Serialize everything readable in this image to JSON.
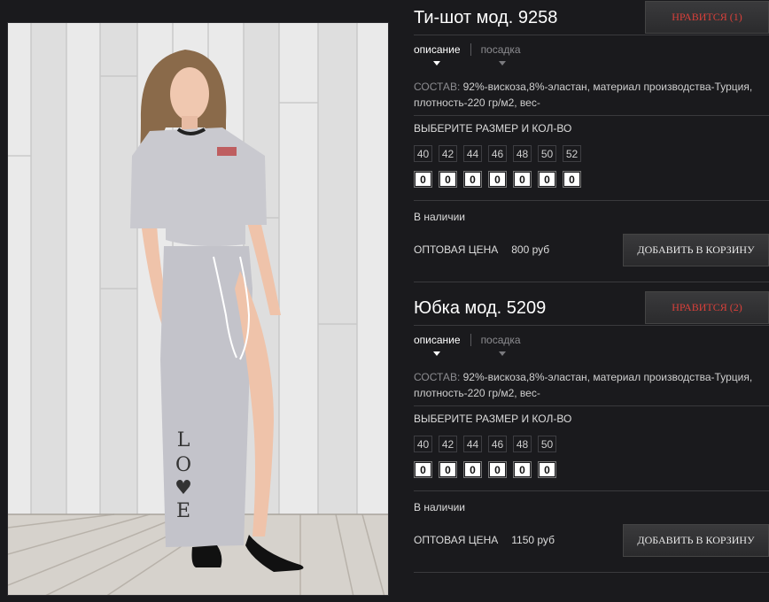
{
  "products": [
    {
      "title": "Ти-шот мод. 9258",
      "like_label": "НРАВИТСЯ (1)",
      "tabs": [
        "описание",
        "посадка"
      ],
      "desc_key": "СОСТАВ:",
      "desc_value": "92%-вискоза,8%-эластан, материал производства-Турция, плотность-220 гр/м2, вес-",
      "size_heading": "ВЫБЕРИТЕ РАЗМЕР И КОЛ-ВО",
      "sizes": [
        "40",
        "42",
        "44",
        "46",
        "48",
        "50",
        "52"
      ],
      "quantities": [
        "0",
        "0",
        "0",
        "0",
        "0",
        "0",
        "0"
      ],
      "stock": "В наличии",
      "price_label": "ОПТОВАЯ ЦЕНА",
      "price_value": "800 руб",
      "cart_label": "ДОБАВИТЬ В КОРЗИНУ"
    },
    {
      "title": "Юбка мод. 5209",
      "like_label": "НРАВИТСЯ (2)",
      "tabs": [
        "описание",
        "посадка"
      ],
      "desc_key": "СОСТАВ:",
      "desc_value": "92%-вискоза,8%-эластан, материал производства-Турция, плотность-220 гр/м2, вес-",
      "size_heading": "ВЫБЕРИТЕ РАЗМЕР И КОЛ-ВО",
      "sizes": [
        "40",
        "42",
        "44",
        "46",
        "48",
        "50"
      ],
      "quantities": [
        "0",
        "0",
        "0",
        "0",
        "0",
        "0"
      ],
      "stock": "В наличии",
      "price_label": "ОПТОВАЯ ЦЕНА",
      "price_value": "1150 руб",
      "cart_label": "ДОБАВИТЬ В КОРЗИНУ"
    }
  ],
  "photo": {
    "icon": "product-photo",
    "skirt_text": "LO♥E"
  },
  "colors": {
    "background": "#1a1a1d",
    "like_text": "#d8403a",
    "garment": "#c9c9cf"
  }
}
